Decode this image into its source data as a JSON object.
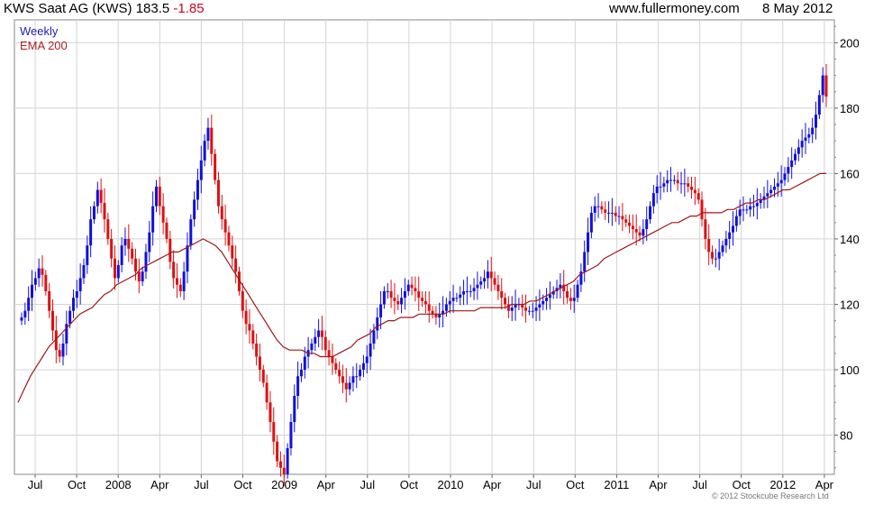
{
  "header": {
    "symbol": "KWS Saat AG (KWS)",
    "price": "183.5",
    "change": "-1.85",
    "site": "www.fullermoney.com",
    "date": "8 May 2012"
  },
  "legend": {
    "series1": "Weekly",
    "series2": "EMA 200"
  },
  "copyright": "© 2012 Stockcube Research Ltd",
  "chart_data": {
    "type": "candlestick",
    "ylim": [
      68,
      207
    ],
    "yticks": [
      80,
      100,
      120,
      140,
      160,
      180,
      200
    ],
    "xticks": [
      "Jul",
      "Oct",
      "2008",
      "Apr",
      "Jul",
      "Oct",
      "2009",
      "Apr",
      "Jul",
      "Oct",
      "2010",
      "Apr",
      "Jul",
      "Oct",
      "2011",
      "Apr",
      "Jul",
      "Oct",
      "2012",
      "Apr"
    ],
    "colors": {
      "up": "#1010e0",
      "down": "#e01010",
      "ema": "#a01818"
    },
    "weekly_close": [
      116,
      118,
      122,
      126,
      128,
      131,
      129,
      124,
      118,
      112,
      106,
      104,
      108,
      114,
      118,
      122,
      124,
      128,
      132,
      138,
      146,
      150,
      155,
      151,
      146,
      140,
      134,
      128,
      132,
      138,
      140,
      137,
      134,
      130,
      127,
      130,
      136,
      142,
      150,
      156,
      150,
      145,
      140,
      133,
      128,
      126,
      124,
      130,
      138,
      146,
      152,
      158,
      164,
      170,
      174,
      166,
      158,
      150,
      146,
      142,
      138,
      134,
      130,
      124,
      118,
      114,
      112,
      108,
      104,
      100,
      96,
      90,
      84,
      78,
      72,
      70,
      68,
      76,
      84,
      92,
      98,
      100,
      104,
      106,
      108,
      110,
      112,
      110,
      106,
      104,
      102,
      100,
      98,
      96,
      94,
      96,
      98,
      98,
      100,
      102,
      104,
      108,
      112,
      116,
      120,
      124,
      124,
      122,
      121,
      120,
      122,
      124,
      126,
      125,
      124,
      122,
      121,
      120,
      118,
      117,
      116,
      117,
      118,
      120,
      121,
      122,
      122,
      123,
      124,
      124,
      124,
      125,
      126,
      127,
      128,
      130,
      128,
      126,
      124,
      122,
      120,
      118,
      119,
      120,
      120,
      119,
      118,
      118,
      118,
      119,
      120,
      121,
      122,
      123,
      124,
      125,
      126,
      124,
      122,
      121,
      122,
      126,
      130,
      136,
      142,
      148,
      150,
      150,
      149,
      148,
      148,
      148,
      147,
      147,
      146,
      145,
      144,
      143,
      142,
      141,
      143,
      146,
      150,
      154,
      156,
      156,
      157,
      158,
      158,
      158,
      157,
      157,
      157,
      156,
      155,
      154,
      152,
      146,
      140,
      136,
      134,
      134,
      136,
      138,
      140,
      142,
      144,
      147,
      149,
      149,
      149,
      150,
      150,
      151,
      152,
      153,
      154,
      155,
      156,
      157,
      158,
      160,
      162,
      164,
      166,
      168,
      170,
      171,
      172,
      174,
      178,
      184,
      190,
      183.5
    ],
    "ema200": [
      90,
      94,
      98,
      101,
      104,
      107,
      109,
      111,
      113,
      115,
      117,
      118,
      119,
      121,
      123,
      124,
      126,
      127,
      128,
      129,
      131,
      132,
      133,
      134,
      135,
      136,
      136,
      137,
      138,
      139,
      140,
      139,
      138,
      136,
      133,
      130,
      127,
      124,
      121,
      118,
      115,
      112,
      109,
      107,
      106,
      106,
      106,
      105,
      105,
      104,
      104,
      104,
      105,
      106,
      107,
      109,
      110,
      111,
      113,
      114,
      115,
      115,
      116,
      116,
      116,
      117,
      117,
      117,
      117,
      117,
      118,
      118,
      118,
      118,
      118,
      119,
      119,
      119,
      119,
      119,
      120,
      120,
      120,
      121,
      121,
      122,
      123,
      124,
      125,
      126,
      127,
      129,
      130,
      131,
      132,
      134,
      135,
      136,
      137,
      138,
      139,
      140,
      141,
      142,
      143,
      144,
      145,
      145,
      146,
      147,
      147,
      148,
      148,
      148,
      148,
      149,
      149,
      150,
      151,
      151,
      152,
      152,
      153,
      154,
      155,
      155,
      156,
      157,
      158,
      159,
      160,
      160
    ]
  }
}
